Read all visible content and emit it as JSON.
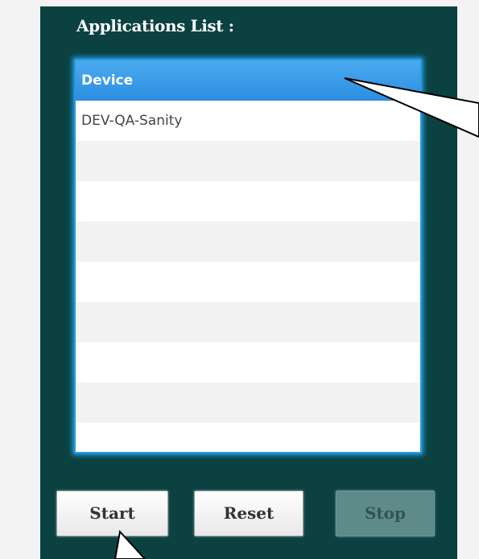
{
  "panel": {
    "title": "Applications List :"
  },
  "list": {
    "header": "Device",
    "rows": [
      "DEV-QA-Sanity",
      "",
      "",
      "",
      "",
      "",
      "",
      "",
      ""
    ]
  },
  "buttons": {
    "start": "Start",
    "reset": "Reset",
    "stop": "Stop"
  },
  "colors": {
    "panel_bg": "#0b4141",
    "header_blue": "#2d8ee0",
    "stop_disabled": "#5f8a8a"
  }
}
